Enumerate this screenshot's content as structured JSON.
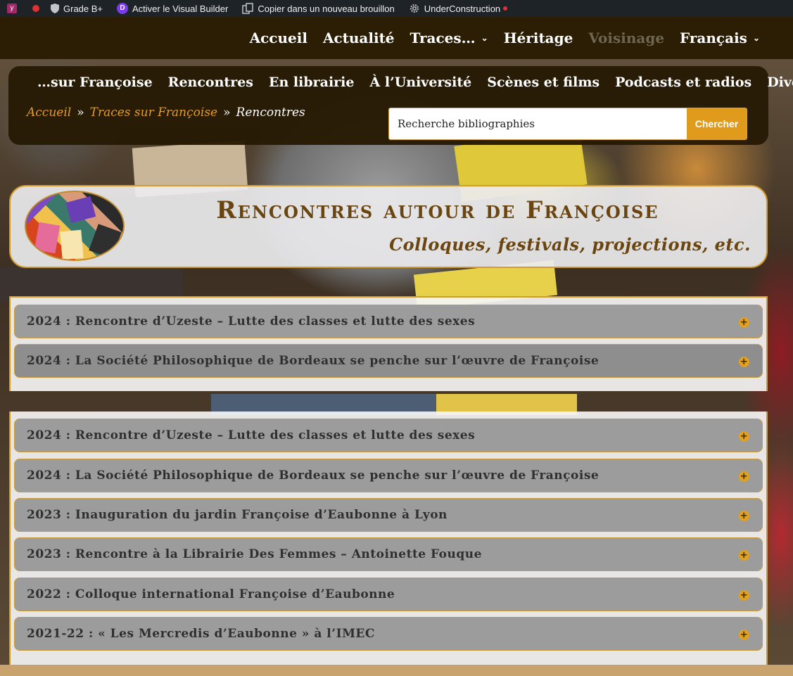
{
  "colors": {
    "admin_bar": "#1d2327",
    "main_nav_bg": "#2b1e05",
    "accent_orange": "#e09a1c",
    "breadcrumb_link": "#e19b2e",
    "title_brown": "#6a4510",
    "accordion_bg": "#9c9c9c",
    "border_gold": "#d19b2f"
  },
  "admin_bar": {
    "items": [
      {
        "label": "",
        "icon": "yoast-icon"
      },
      {
        "label": "",
        "icon": "status-dot-icon"
      },
      {
        "label": "Grade B+",
        "icon": "shield-icon"
      },
      {
        "label": "Activer le Visual Builder",
        "icon": "divi-icon"
      },
      {
        "label": "Copier dans un nouveau brouillon",
        "icon": "copy-icon"
      },
      {
        "label": "UnderConstruction",
        "icon": "gear-icon"
      }
    ],
    "divi_letter": "D"
  },
  "main_nav": {
    "items": [
      {
        "label": "Accueil"
      },
      {
        "label": "Actualité"
      },
      {
        "label": "Traces…",
        "dropdown": true
      },
      {
        "label": "Héritage"
      },
      {
        "label": "Voisinage",
        "dimmed": true
      },
      {
        "label": "Français",
        "dropdown": true
      }
    ],
    "chevron": "⌄"
  },
  "sub_nav": {
    "items": [
      {
        "label": "…sur Françoise"
      },
      {
        "label": "Rencontres"
      },
      {
        "label": "En librairie"
      },
      {
        "label": "À l’Université"
      },
      {
        "label": "Scènes et films"
      },
      {
        "label": "Podcasts et radios"
      },
      {
        "label": "Divers"
      }
    ]
  },
  "breadcrumb": {
    "home": "Accueil",
    "parent": "Traces sur Françoise",
    "current": "Rencontres",
    "separator": "»"
  },
  "search": {
    "placeholder": "Recherche bibliographies",
    "button": "Chercher"
  },
  "banner": {
    "title": "Rencontres autour de Françoise",
    "subtitle": "Colloques, festivals, projections, etc."
  },
  "accordion_top": [
    {
      "label": "2024 : Rencontre d’Uzeste – Lutte des classes et lutte des sexes"
    },
    {
      "label": "2024 : La Société Philosophique de Bordeaux se penche sur l’œuvre de Françoise"
    }
  ],
  "accordion_main": [
    {
      "label": "2024 : Rencontre d’Uzeste – Lutte des classes et lutte des sexes"
    },
    {
      "label": "2024 : La Société Philosophique de Bordeaux se penche sur l’œuvre de Françoise"
    },
    {
      "label": "2023 : Inauguration du jardin Françoise d’Eaubonne à Lyon"
    },
    {
      "label": "2023 : Rencontre à la Librairie Des Femmes – Antoinette Fouque"
    },
    {
      "label": "2022 : Colloque international Françoise d’Eaubonne"
    },
    {
      "label": "2021-22 : « Les Mercredis d’Eaubonne » à l’IMEC"
    }
  ],
  "accordion_toggle_symbol": "+"
}
